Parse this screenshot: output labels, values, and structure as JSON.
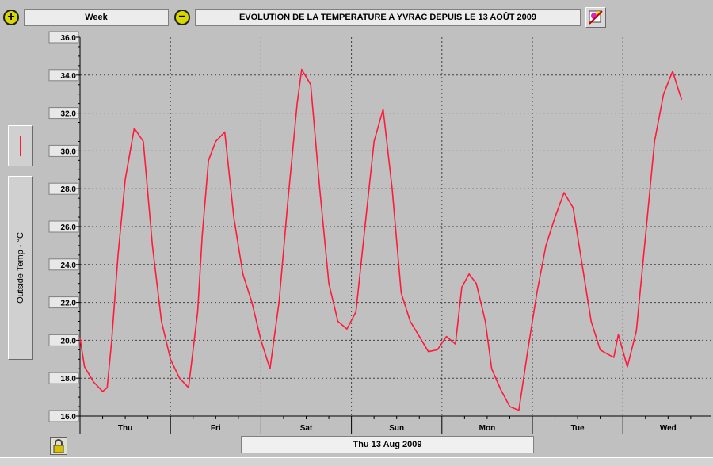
{
  "toolbar": {
    "zoom_in_icon": "zoom-in-icon",
    "zoom_out_icon": "zoom-out-icon",
    "period": "Week",
    "title": "EVOLUTION DE LA TEMPERATURE A YVRAC DEPUIS LE 13 AOÛT 2009",
    "export_icon": "palette-icon"
  },
  "legend": {
    "series_color": "#ff1a3a",
    "series_label": "Outside Temp - °C"
  },
  "footer": {
    "lock_icon": "lock-icon",
    "date_label": "Thu 13 Aug 2009"
  },
  "chart_data": {
    "type": "line",
    "ylabel": "Outside Temp - °C",
    "ylim": [
      16.0,
      36.0
    ],
    "yticks": [
      "16.0",
      "18.0",
      "20.0",
      "22.0",
      "24.0",
      "26.0",
      "28.0",
      "30.0",
      "32.0",
      "34.0",
      "36.0"
    ],
    "x_tick_labels": [
      "Thu",
      "Fri",
      "Sat",
      "Sun",
      "Mon",
      "Tue",
      "Wed"
    ],
    "xlim_days": [
      0,
      7
    ],
    "grid": true,
    "line_color": "#ff1a3a",
    "series": [
      {
        "x": [
          0.0,
          0.05,
          0.15,
          0.25,
          0.3,
          0.35,
          0.42,
          0.5,
          0.6,
          0.7,
          0.8,
          0.9,
          1.0,
          1.1,
          1.2,
          1.3,
          1.35,
          1.42,
          1.5,
          1.6,
          1.7,
          1.8,
          1.9,
          2.0,
          2.1,
          2.2,
          2.3,
          2.4,
          2.45,
          2.55,
          2.65,
          2.75,
          2.85,
          2.95,
          3.05,
          3.15,
          3.25,
          3.35,
          3.45,
          3.55,
          3.65,
          3.75,
          3.85,
          3.95,
          4.05,
          4.15,
          4.22,
          4.3,
          4.38,
          4.48,
          4.55,
          4.65,
          4.75,
          4.85,
          4.95,
          5.05,
          5.15,
          5.25,
          5.35,
          5.45,
          5.55,
          5.65,
          5.75,
          5.82,
          5.9,
          5.95,
          6.05,
          6.15,
          6.25,
          6.35,
          6.45,
          6.55,
          6.65
        ],
        "y": [
          20.1,
          18.6,
          17.8,
          17.3,
          17.5,
          20.0,
          24.5,
          28.5,
          31.2,
          30.5,
          25.0,
          21.0,
          19.0,
          18.0,
          17.5,
          21.5,
          25.5,
          29.5,
          30.5,
          31.0,
          26.5,
          23.5,
          22.0,
          20.0,
          18.5,
          22.0,
          27.5,
          32.5,
          34.3,
          33.5,
          28.0,
          23.0,
          21.0,
          20.6,
          21.5,
          26.0,
          30.5,
          32.2,
          28.0,
          22.5,
          21.0,
          20.2,
          19.4,
          19.5,
          20.2,
          19.8,
          22.8,
          23.5,
          23.0,
          21.0,
          18.5,
          17.4,
          16.5,
          16.3,
          19.5,
          22.5,
          25.0,
          26.5,
          27.8,
          27.0,
          24.0,
          21.0,
          19.5,
          19.3,
          19.1,
          20.3,
          18.6,
          20.5,
          25.5,
          30.5,
          33.0,
          34.2,
          32.7
        ]
      }
    ]
  }
}
